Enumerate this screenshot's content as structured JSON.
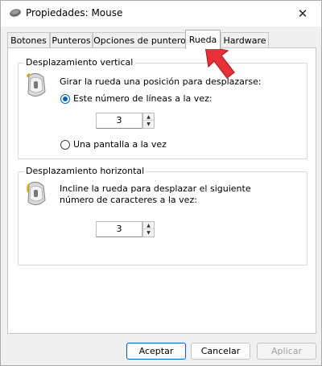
{
  "window": {
    "title": "Propiedades: Mouse",
    "title_icon": "mouse-icon",
    "close_glyph": "✕"
  },
  "tabs": [
    {
      "label": "Botones",
      "active": false
    },
    {
      "label": "Punteros",
      "active": false
    },
    {
      "label": "Opciones de puntero",
      "active": false
    },
    {
      "label": "Rueda",
      "active": true
    },
    {
      "label": "Hardware",
      "active": false
    }
  ],
  "vertical": {
    "title": "Desplazamiento vertical",
    "icon": "mouse-wheel-icon",
    "description": "Girar la rueda una posición para desplazarse:",
    "option_lines_label": "Este número de líneas a la vez:",
    "option_lines_checked": true,
    "lines_value": "3",
    "option_screen_label": "Una pantalla a la vez",
    "option_screen_checked": false
  },
  "horizontal": {
    "title": "Desplazamiento horizontal",
    "icon": "mouse-tilt-icon",
    "description_line1": "Incline la rueda para desplazar el siguiente",
    "description_line2": "número de caracteres a la vez:",
    "chars_value": "3"
  },
  "buttons": {
    "accept": "Aceptar",
    "cancel": "Cancelar",
    "apply": "Aplicar"
  },
  "colors": {
    "accent": "#005fb8",
    "annotation_arrow": "#e8303a"
  }
}
